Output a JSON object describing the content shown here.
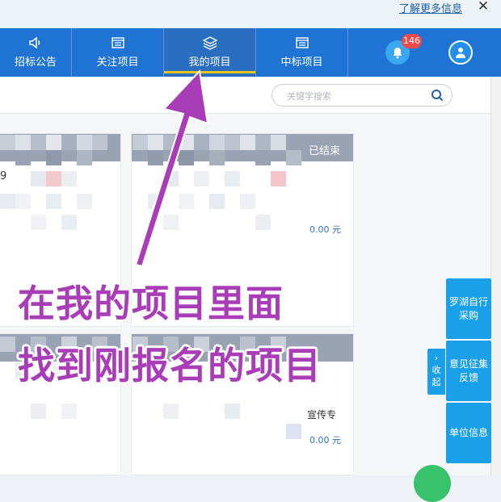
{
  "header": {
    "learn_more": "了解更多信息",
    "close_glyph": "✕"
  },
  "nav": {
    "tabs": [
      {
        "label": "招标公告",
        "icon": "speaker-icon"
      },
      {
        "label": "关注项目",
        "icon": "list-icon"
      },
      {
        "label": "我的项目",
        "icon": "layers-icon",
        "active": true
      },
      {
        "label": "中标项目",
        "icon": "list-icon"
      }
    ],
    "notification_count": "146"
  },
  "search": {
    "placeholder": "关键字搜索"
  },
  "cards": {
    "status": "已结束",
    "digit": "9",
    "amounts": [
      "0.00 元",
      "0.00 元"
    ],
    "partial_text": "宣传专"
  },
  "annotation": {
    "line1": "在我的项目里面",
    "line2": "找到刚报名的项目"
  },
  "side_buttons": {
    "fold": "收起",
    "btn1": "罗湖自行采购",
    "btn2": "意见征集反馈",
    "btn3": "单位信息"
  },
  "colors": {
    "nav_blue": "#1f74d3",
    "accent_yellow": "#f0c419",
    "annotation_purple": "#a93db7",
    "side_blue": "#1aa0e9"
  }
}
